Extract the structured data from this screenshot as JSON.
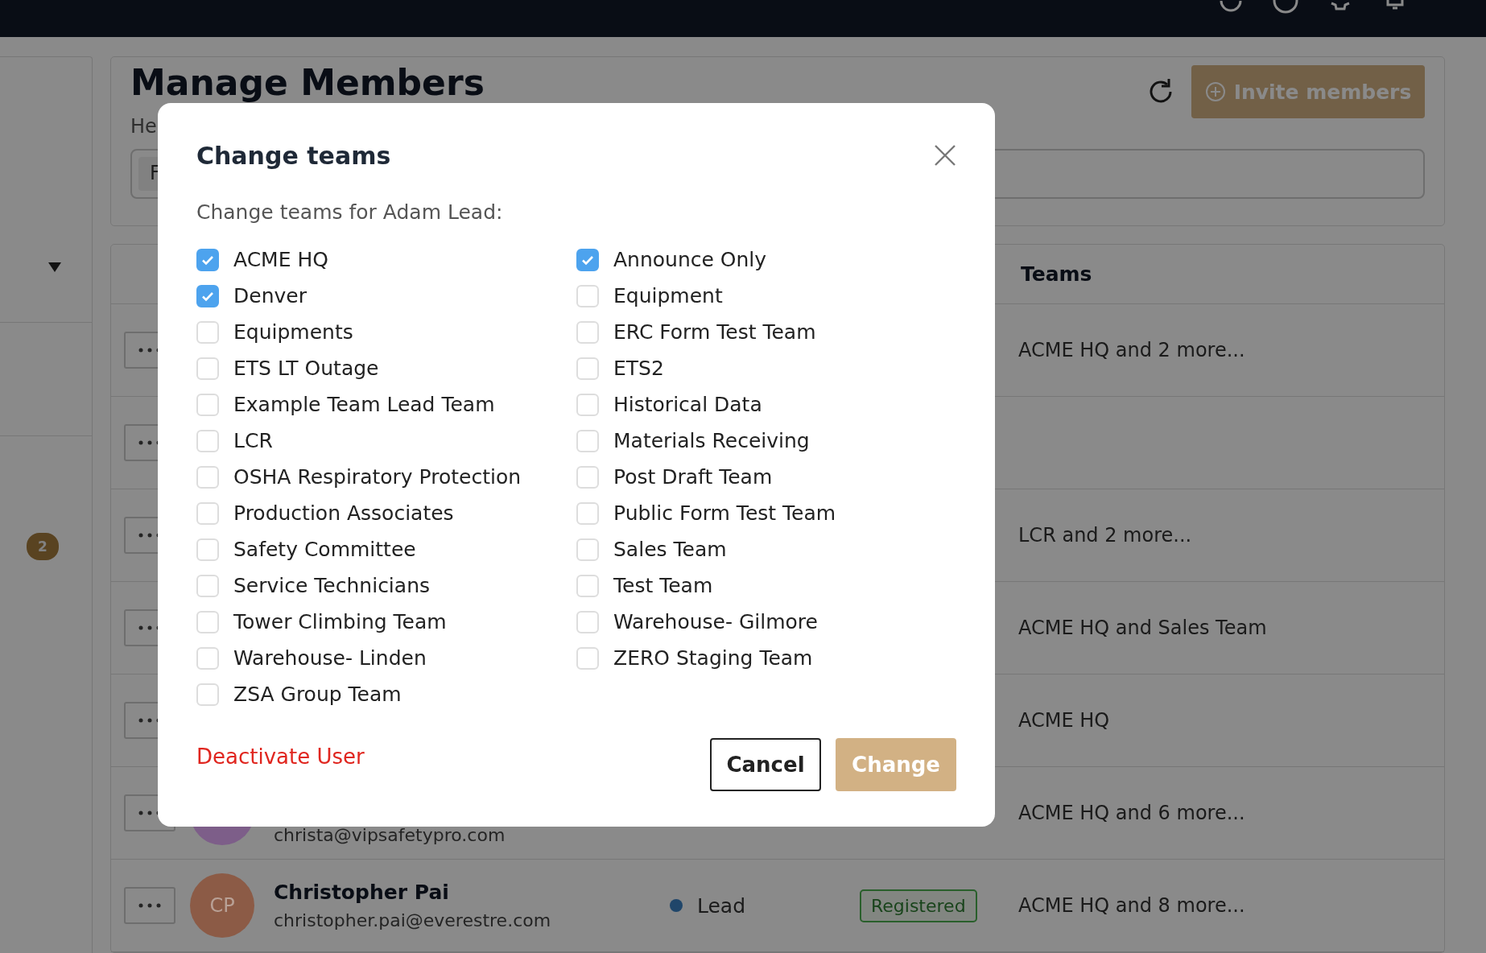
{
  "sidebar": {
    "badge": "2"
  },
  "header": {
    "title": "Manage Members",
    "subtitle": "He",
    "search": {
      "value": "F"
    },
    "invite_button": "Invite members"
  },
  "table": {
    "columns": [
      {
        "label": "Teams"
      }
    ],
    "rows": [
      {
        "teams": "ACME HQ and 2 more..."
      },
      {},
      {
        "teams": "LCR and 2 more..."
      },
      {
        "teams": "ACME HQ and Sales Team"
      },
      {
        "teams": "ACME HQ"
      },
      {
        "email": "christa@vipsafetypro.com",
        "color": "#7d5e89",
        "teams": "ACME HQ and 6 more..."
      },
      {
        "name": "Christopher Pai",
        "email": "christopher.pai@everestre.com",
        "initials": "CP",
        "color": "#8c5b46",
        "role": "Lead",
        "status": "Registered",
        "teams": "ACME HQ and 8 more..."
      }
    ]
  },
  "dialog": {
    "title": "Change teams",
    "subtitle": "Change teams for Adam Lead:",
    "teams": [
      {
        "label": "ACME HQ",
        "checked": true
      },
      {
        "label": "Denver",
        "checked": true
      },
      {
        "label": "Equipments",
        "checked": false
      },
      {
        "label": "ETS LT Outage",
        "checked": false
      },
      {
        "label": "Example Team Lead Team",
        "checked": false
      },
      {
        "label": "LCR",
        "checked": false
      },
      {
        "label": "OSHA Respiratory Protection",
        "checked": false
      },
      {
        "label": "Production Associates",
        "checked": false
      },
      {
        "label": "Safety Committee",
        "checked": false
      },
      {
        "label": "Service Technicians",
        "checked": false
      },
      {
        "label": "Tower Climbing Team",
        "checked": false
      },
      {
        "label": "Warehouse- Linden",
        "checked": false
      },
      {
        "label": "ZSA Group Team",
        "checked": false
      },
      {
        "label": "Announce Only",
        "checked": true
      },
      {
        "label": "Equipment",
        "checked": false
      },
      {
        "label": "ERC Form Test Team",
        "checked": false
      },
      {
        "label": "ETS2",
        "checked": false
      },
      {
        "label": "Historical Data",
        "checked": false
      },
      {
        "label": "Materials Receiving",
        "checked": false
      },
      {
        "label": "Post Draft Team",
        "checked": false
      },
      {
        "label": "Public Form Test Team",
        "checked": false
      },
      {
        "label": "Sales Team",
        "checked": false
      },
      {
        "label": "Test Team",
        "checked": false
      },
      {
        "label": "Warehouse- Gilmore",
        "checked": false
      },
      {
        "label": "ZERO Staging Team",
        "checked": false
      }
    ],
    "deactivate_link": "Deactivate User",
    "cancel_button": "Cancel",
    "confirm_button": "Change"
  }
}
